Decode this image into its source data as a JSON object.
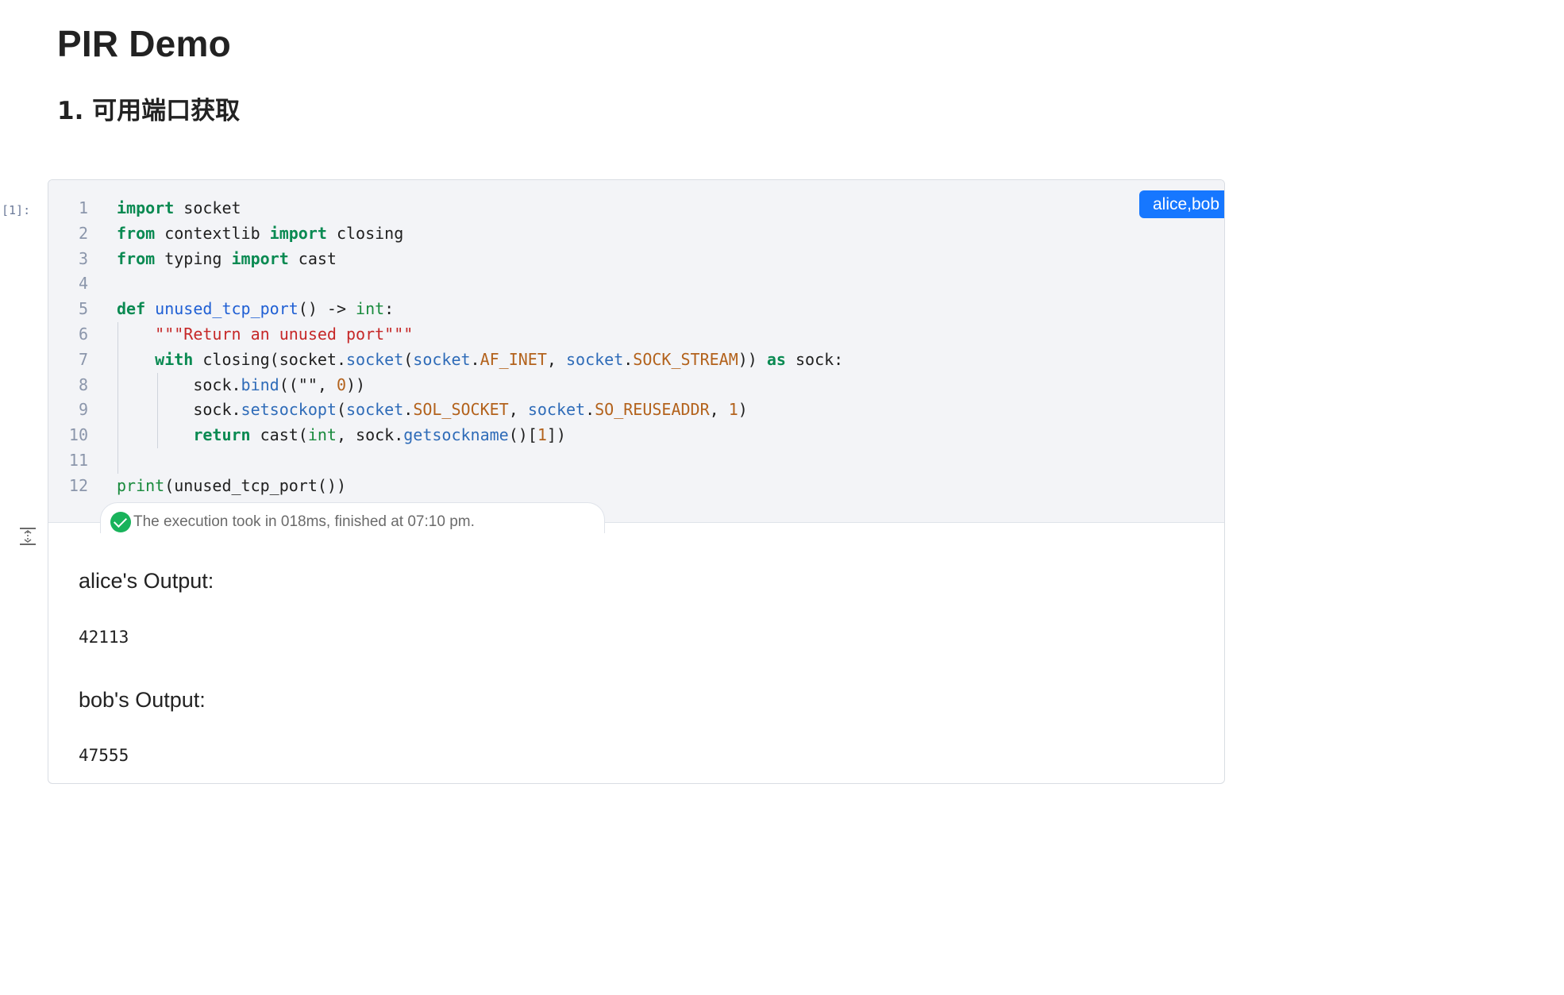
{
  "notebook": {
    "title": "PIR Demo",
    "section_heading": "1. 可用端口获取"
  },
  "cell": {
    "prompt": "[1]:",
    "party_tag": "alice,bob",
    "code_lines": [
      [
        {
          "t": "import",
          "c": "kw"
        },
        {
          "t": " socket"
        }
      ],
      [
        {
          "t": "from",
          "c": "kw"
        },
        {
          "t": " contextlib "
        },
        {
          "t": "import",
          "c": "kw"
        },
        {
          "t": " closing"
        }
      ],
      [
        {
          "t": "from",
          "c": "kw"
        },
        {
          "t": " typing "
        },
        {
          "t": "import",
          "c": "kw"
        },
        {
          "t": " cast"
        }
      ],
      [],
      [
        {
          "t": "def",
          "c": "kw"
        },
        {
          "t": " "
        },
        {
          "t": "unused_tcp_port",
          "c": "fn"
        },
        {
          "t": "() -> "
        },
        {
          "t": "int",
          "c": "bi"
        },
        {
          "t": ":"
        }
      ],
      [
        {
          "t": "    "
        },
        {
          "t": "\"\"\"Return an unused port\"\"\"",
          "c": "str"
        }
      ],
      [
        {
          "t": "    "
        },
        {
          "t": "with",
          "c": "kw"
        },
        {
          "t": " closing(socket."
        },
        {
          "t": "socket",
          "c": "attr"
        },
        {
          "t": "("
        },
        {
          "t": "socket",
          "c": "attr"
        },
        {
          "t": "."
        },
        {
          "t": "AF_INET",
          "c": "const"
        },
        {
          "t": ", "
        },
        {
          "t": "socket",
          "c": "attr"
        },
        {
          "t": "."
        },
        {
          "t": "SOCK_STREAM",
          "c": "const"
        },
        {
          "t": ")) "
        },
        {
          "t": "as",
          "c": "kw"
        },
        {
          "t": " sock:"
        }
      ],
      [
        {
          "t": "        sock."
        },
        {
          "t": "bind",
          "c": "attr"
        },
        {
          "t": "((\"\", "
        },
        {
          "t": "0",
          "c": "num"
        },
        {
          "t": "))"
        }
      ],
      [
        {
          "t": "        sock."
        },
        {
          "t": "setsockopt",
          "c": "attr"
        },
        {
          "t": "("
        },
        {
          "t": "socket",
          "c": "attr"
        },
        {
          "t": "."
        },
        {
          "t": "SOL_SOCKET",
          "c": "const"
        },
        {
          "t": ", "
        },
        {
          "t": "socket",
          "c": "attr"
        },
        {
          "t": "."
        },
        {
          "t": "SO_REUSEADDR",
          "c": "const"
        },
        {
          "t": ", "
        },
        {
          "t": "1",
          "c": "num"
        },
        {
          "t": ")"
        }
      ],
      [
        {
          "t": "        "
        },
        {
          "t": "return",
          "c": "kw"
        },
        {
          "t": " cast("
        },
        {
          "t": "int",
          "c": "bi"
        },
        {
          "t": ", sock."
        },
        {
          "t": "getsockname",
          "c": "attr"
        },
        {
          "t": "()["
        },
        {
          "t": "1",
          "c": "num"
        },
        {
          "t": "])"
        }
      ],
      [],
      [
        {
          "t": "print",
          "c": "bi"
        },
        {
          "t": "(unused_tcp_port())"
        }
      ]
    ],
    "execution_status": "The execution took in 018ms, finished at 07:10 pm."
  },
  "outputs": [
    {
      "label": "alice's Output:",
      "value": "42113"
    },
    {
      "label": "bob's Output:",
      "value": "47555"
    }
  ],
  "colors": {
    "keyword": "#0a8a52",
    "function": "#1f5fd4",
    "attribute": "#2e6bb8",
    "constant": "#b3621c",
    "string": "#c62828",
    "builtin": "#188a3c",
    "tag_bg": "#1677ff",
    "success": "#19b35b"
  },
  "icons": {
    "status": "check-circle-icon",
    "output_toggle": "collapse-expand-icon"
  }
}
